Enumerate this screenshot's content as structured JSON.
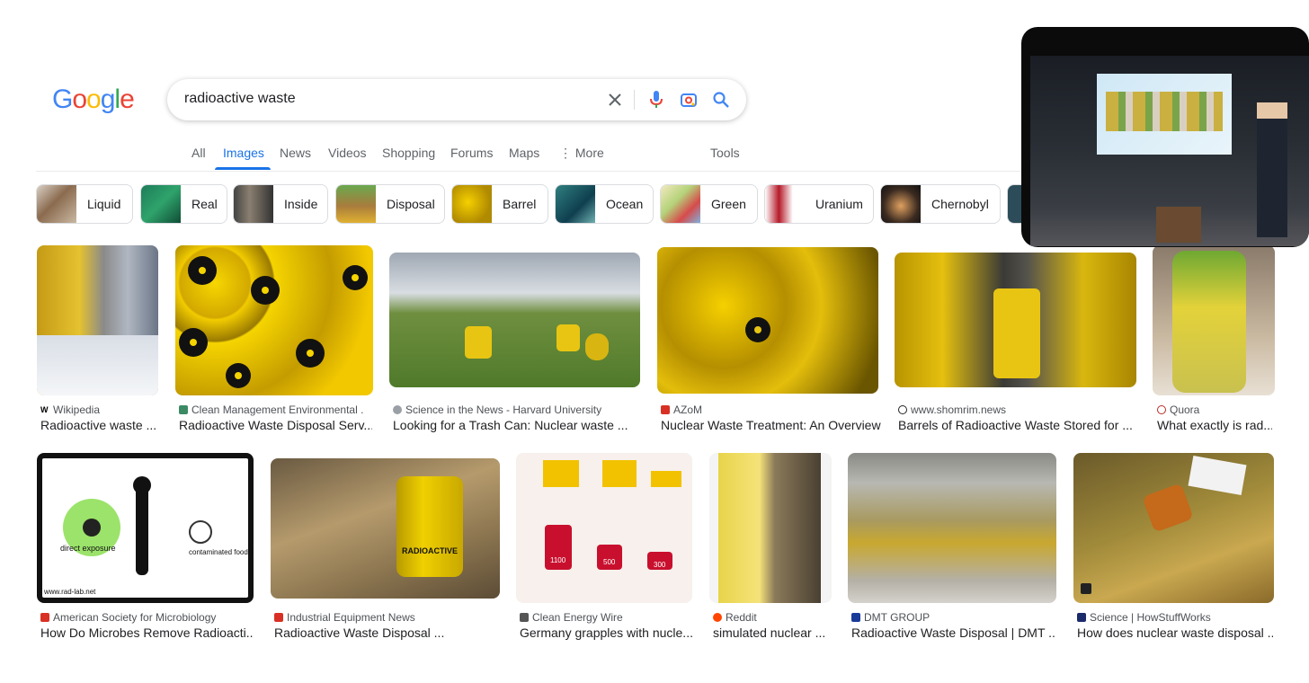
{
  "logo": "Google",
  "search": {
    "value": "radioactive waste"
  },
  "tabs": [
    "All",
    "Images",
    "News",
    "Videos",
    "Shopping",
    "Forums",
    "Maps",
    "More"
  ],
  "tools": "Tools",
  "chips": [
    "Liquid",
    "Real",
    "Inside",
    "Disposal",
    "Barrel",
    "Ocean",
    "Green",
    "Uranium",
    "Chernobyl"
  ],
  "results": [
    {
      "source": "Wikipedia",
      "title": "Radioactive waste ..."
    },
    {
      "source": "Clean Management Environmental ...",
      "title": "Radioactive Waste Disposal Serv..."
    },
    {
      "source": "Science in the News - Harvard University",
      "title": "Looking for a Trash Can: Nuclear waste ..."
    },
    {
      "source": "AZoM",
      "title": "Nuclear Waste Treatment: An Overview"
    },
    {
      "source": "www.shomrim.news",
      "title": "Barrels of Radioactive Waste Stored for ..."
    },
    {
      "source": "Quora",
      "title": "What exactly is rad..."
    },
    {
      "source": "American Society for Microbiology",
      "title": "How Do Microbes Remove Radioacti..."
    },
    {
      "source": "Industrial Equipment News",
      "title": "Radioactive Waste Disposal ..."
    },
    {
      "source": "Clean Energy Wire",
      "title": "Germany grapples with nucle..."
    },
    {
      "source": "Reddit",
      "title": "simulated nuclear ..."
    },
    {
      "source": "DMT GROUP",
      "title": "Radioactive Waste Disposal | DMT ..."
    },
    {
      "source": "Science | HowStuffWorks",
      "title": "How does nuclear waste disposal ..."
    }
  ],
  "image_text": {
    "diagram_labels": [
      "direct exposure",
      "contaminated food",
      "www.rad-lab.net"
    ],
    "barrel_label": "RADIOACTIVE",
    "chart_values": [
      "1100",
      "500",
      "300"
    ]
  },
  "colors": {
    "accent": "#1a73e8",
    "radiation_yellow": "#e8c513"
  }
}
